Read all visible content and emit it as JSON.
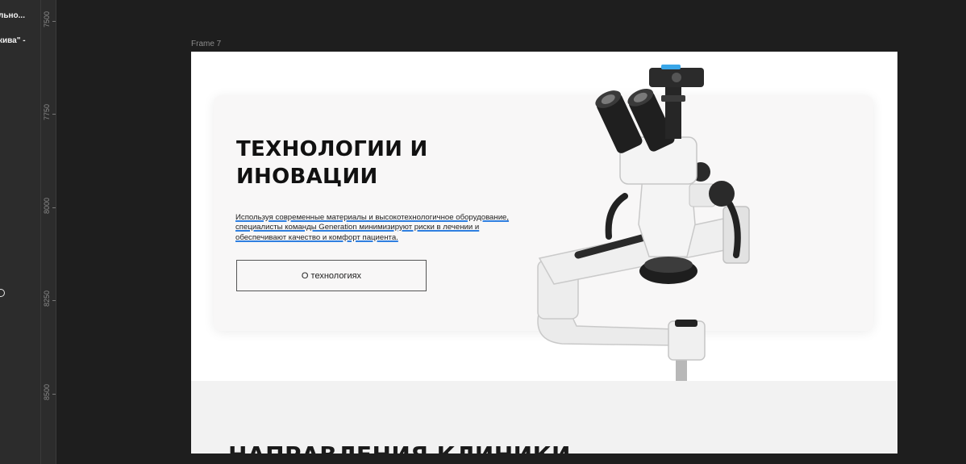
{
  "layers_panel": {
    "items": [
      {
        "label": "льно..."
      },
      {
        "label": "кива\" -"
      }
    ]
  },
  "ruler": {
    "ticks": [
      "7500",
      "7750",
      "8000",
      "8250",
      "8500"
    ]
  },
  "frame": {
    "label": "Frame 7"
  },
  "hero": {
    "title": "ТЕХНОЛОГИИ И ИНОВАЦИИ",
    "description": "Используя современные материалы и высокотехнологичное оборудование, специалисты команды Generation минимизируют риски в лечении и обеспечивают качество и комфорт пациента.",
    "button_label": "О технологиях",
    "image_alt": "microscope-image"
  },
  "section2": {
    "title": "НАПРАВЛЕНИЯ КЛИНИКИ"
  },
  "colors": {
    "canvas": "#1e1e1e",
    "panel": "#2c2c2c",
    "card": "#f8f7f7",
    "highlight": "#2f7fe0",
    "camera_accent": "#39a6e8"
  }
}
